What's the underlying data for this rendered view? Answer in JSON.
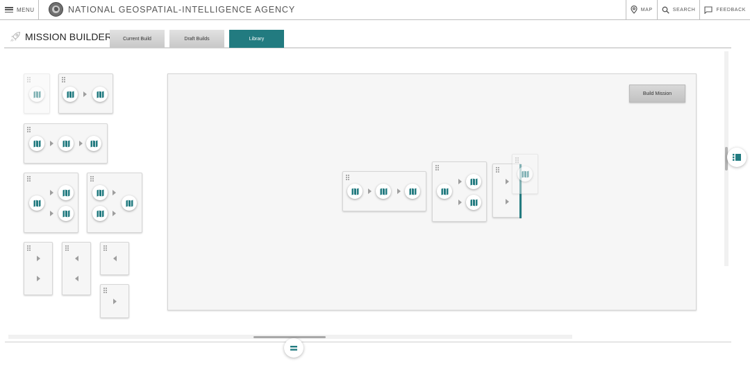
{
  "header": {
    "menu_label": "MENU",
    "agency_name": "NATIONAL GEOSPATIAL-INTELLIGENCE AGENCY",
    "actions": {
      "map": "MAP",
      "search": "SEARCH",
      "feedback": "FEEDBACK"
    }
  },
  "builder": {
    "title": "MISSION BUILDER",
    "tabs": [
      {
        "label": "Current Build",
        "active": false
      },
      {
        "label": "Draft Builds",
        "active": false
      },
      {
        "label": "Library",
        "active": true
      }
    ]
  },
  "canvas": {
    "build_button": "Build Mission"
  },
  "icons": {
    "node": "map-icon",
    "connector": "arrow-right-icon",
    "drag": "drag-handle-icon",
    "brand": "rocket-icon",
    "side_panel": "list-panel-icon",
    "bottom_panel": "equals-icon"
  },
  "colors": {
    "accent": "#227b80",
    "tab_inactive": "#d0d0d0",
    "canvas_bg": "#f6f6f6"
  }
}
